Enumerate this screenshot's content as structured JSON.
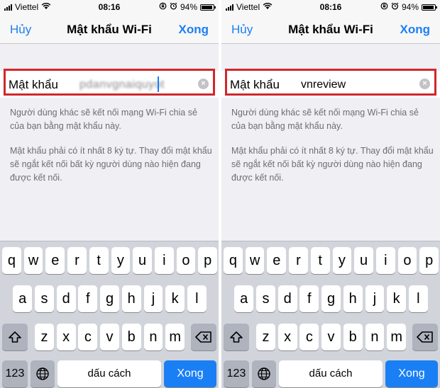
{
  "status": {
    "carrier": "Viettel",
    "time": "08:16",
    "battery": "94%",
    "battery_level": 0.94
  },
  "screens": [
    {
      "nav": {
        "cancel": "Hủy",
        "title": "Mật khẩu Wi-Fi",
        "done": "Xong"
      },
      "field": {
        "label": "Mật khẩu",
        "value": "pdanvgnaiquyot"
      },
      "help1": "Người dùng khác sẽ kết nối mạng Wi-Fi chia sẻ của bạn bằng mật khẩu này.",
      "help2": "Mật khẩu phải có ít nhất 8 ký tự. Thay đổi mật khẩu sẽ ngắt kết nối bất kỳ người dùng nào hiện đang được kết nối."
    },
    {
      "nav": {
        "cancel": "Hủy",
        "title": "Mật khẩu Wi-Fi",
        "done": "Xong"
      },
      "field": {
        "label": "Mật khẩu",
        "value": "vnreview"
      },
      "help1": "Người dùng khác sẽ kết nối mạng Wi-Fi chia sẻ của bạn bằng mật khẩu này.",
      "help2": "Mật khẩu phải có ít nhất 8 ký tự. Thay đổi mật khẩu sẽ ngắt kết nối bất kỳ người dùng nào hiện đang được kết nối."
    }
  ],
  "keyboard": {
    "row1": [
      "q",
      "w",
      "e",
      "r",
      "t",
      "y",
      "u",
      "i",
      "o",
      "p"
    ],
    "row2": [
      "a",
      "s",
      "d",
      "f",
      "g",
      "h",
      "j",
      "k",
      "l"
    ],
    "row3": [
      "z",
      "x",
      "c",
      "v",
      "b",
      "n",
      "m"
    ],
    "numbers": "123",
    "space": "dấu cách",
    "return": "Xong"
  },
  "icons": {
    "shift": "shift-icon",
    "backspace": "backspace-icon",
    "globe": "globe-icon",
    "wifi": "wifi-icon",
    "lock": "rotation-lock-icon",
    "alarm": "alarm-icon",
    "clear": "clear-text-icon"
  },
  "colors": {
    "accent": "#1a7ff5",
    "highlight": "#d0272b",
    "keyboard_bg": "#d1d4da"
  }
}
